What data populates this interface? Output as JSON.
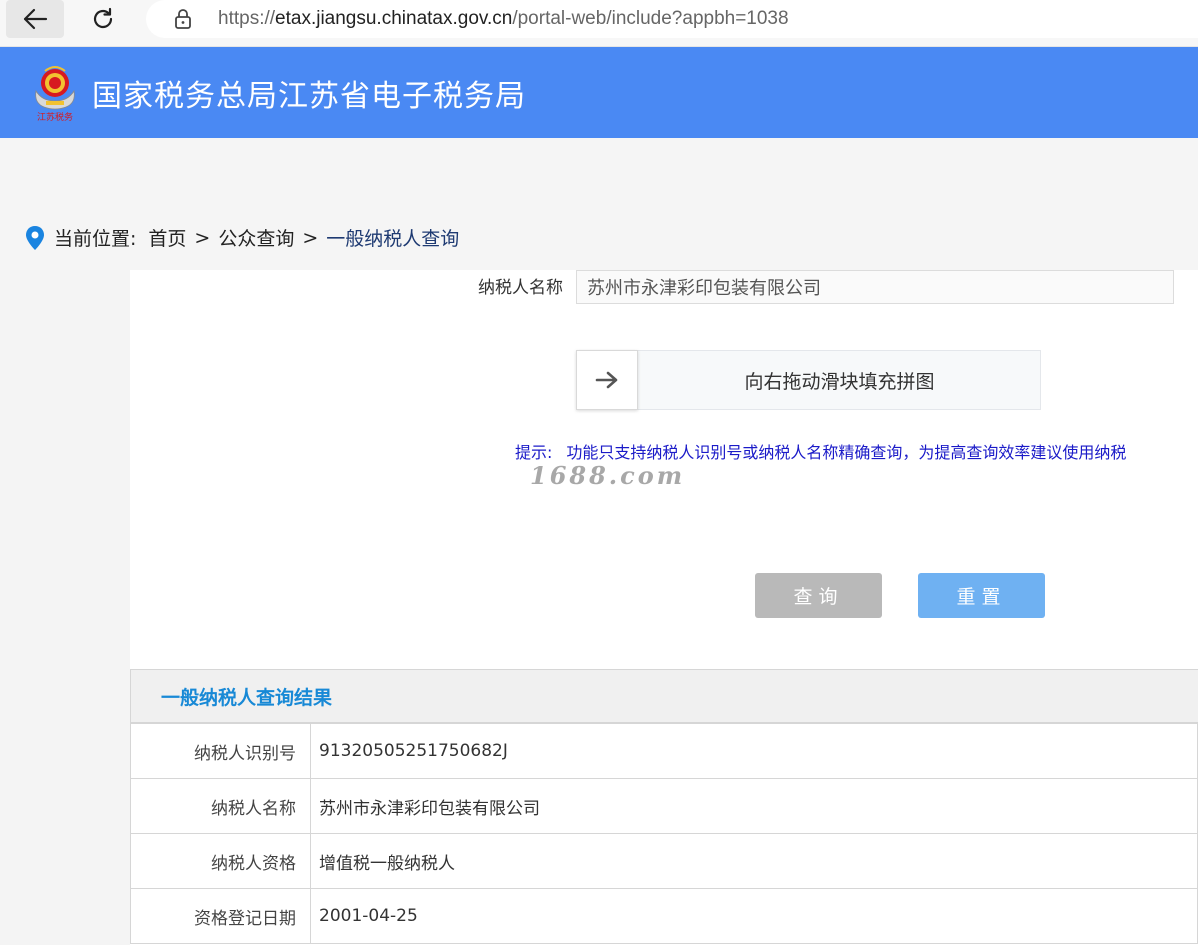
{
  "browser": {
    "url_host_prefix": "https://",
    "url_host": "etax.jiangsu.chinatax.gov.cn",
    "url_path": "/portal-web/include?appbh=1038"
  },
  "header": {
    "title": "国家税务总局江苏省电子税务局",
    "emblem_caption": "江苏税务",
    "brand_color": "#4a89f3"
  },
  "breadcrumb": {
    "label": "当前位置:",
    "items": [
      "首页",
      "公众查询",
      "一般纳税人查询"
    ],
    "separator": ">"
  },
  "form": {
    "taxpayer_name_label": "纳税人名称",
    "taxpayer_name_value": "苏州市永津彩印包装有限公司",
    "slider_text": "向右拖动滑块填充拼图",
    "slider_progress": 0,
    "tip_label": "提示:",
    "tip_text": "功能只支持纳税人识别号或纳税人名称精确查询，为提高查询效率建议使用纳税",
    "query_button": "查询",
    "reset_button": "重置"
  },
  "watermark": "1688.com",
  "result": {
    "title": "一般纳税人查询结果",
    "rows": [
      {
        "key": "纳税人识别号",
        "value": "91320505251750682J"
      },
      {
        "key": "纳税人名称",
        "value": "苏州市永津彩印包装有限公司"
      },
      {
        "key": "纳税人资格",
        "value": "增值税一般纳税人"
      },
      {
        "key": "资格登记日期",
        "value": "2001-04-25"
      }
    ]
  }
}
